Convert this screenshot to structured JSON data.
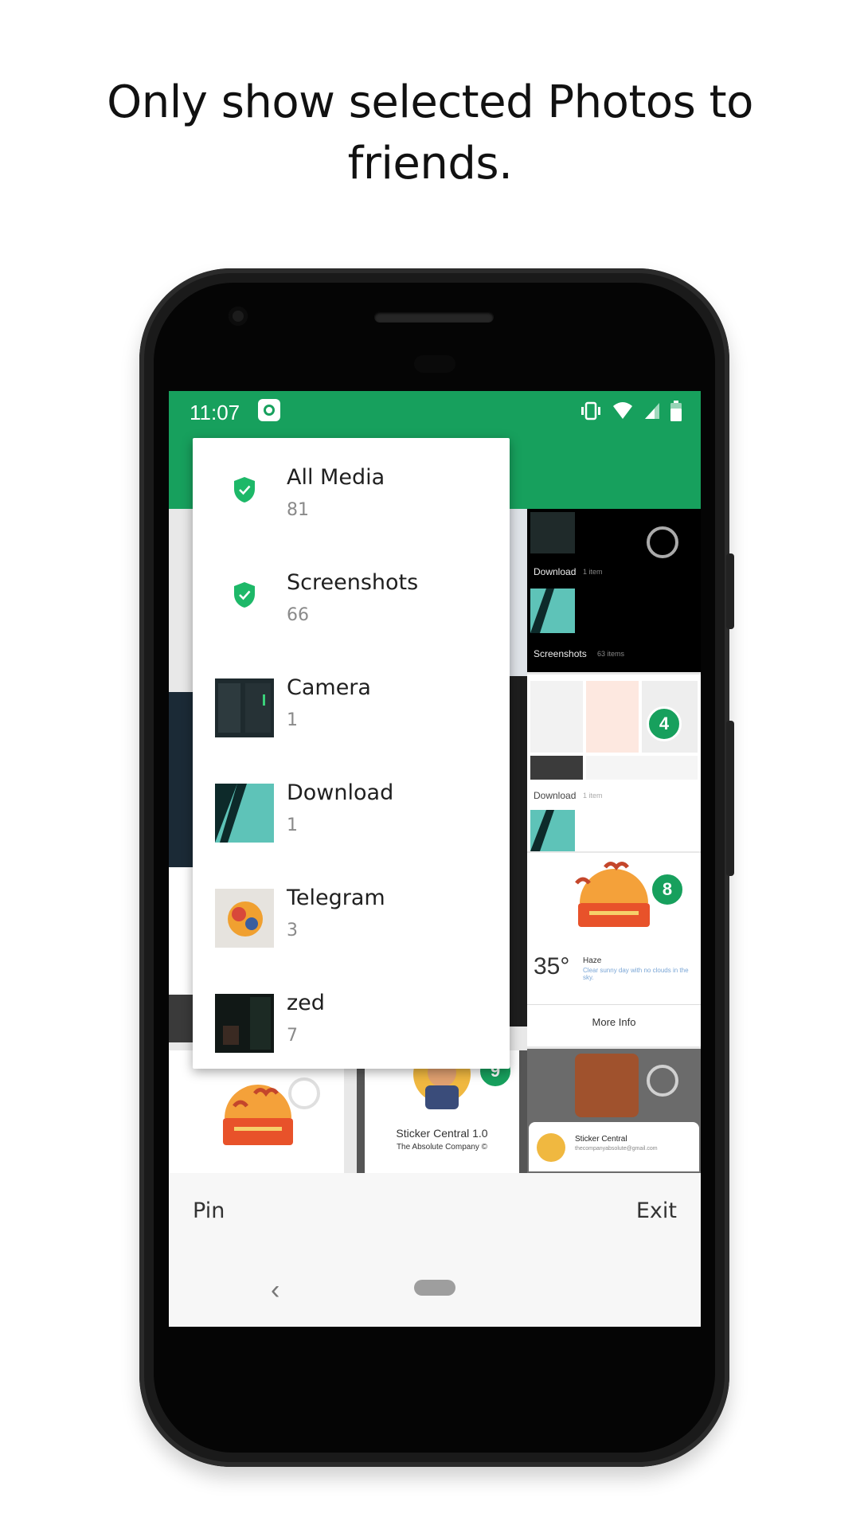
{
  "headline": "Only show selected Photos to friends.",
  "status_bar": {
    "time": "11:07",
    "app_icon": "app-logo-icon",
    "icons": [
      "vibrate-icon",
      "wifi-icon",
      "signal-icon",
      "battery-icon"
    ]
  },
  "colors": {
    "primary": "#17a05d",
    "badge": "#17a05d",
    "menu_bg": "#ffffff"
  },
  "folder_menu": {
    "items": [
      {
        "title": "All Media",
        "count": "81",
        "icon": "shield-icon"
      },
      {
        "title": "Screenshots",
        "count": "66",
        "icon": "shield-icon"
      },
      {
        "title": "Camera",
        "count": "1",
        "icon": "camera-thumbnail"
      },
      {
        "title": "Download",
        "count": "1",
        "icon": "download-thumbnail"
      },
      {
        "title": "Telegram",
        "count": "3",
        "icon": "telegram-thumbnail"
      },
      {
        "title": "zed",
        "count": "7",
        "icon": "zed-thumbnail"
      }
    ]
  },
  "grid": {
    "tile_download_label": "Download",
    "tile_download_count": "1 item",
    "tile_screenshots_label": "Screenshots",
    "tile_screenshots_count": "63 items",
    "tile_download2_label": "Download",
    "tile_download2_count": "1 item",
    "badge_4": "4",
    "badge_8": "8",
    "badge_9": "9",
    "weather_temp": "35°",
    "weather_cond": "Haze",
    "weather_desc": "Clear sunny day with no clouds in the sky.",
    "more_info": "More Info",
    "sticker_title": "Sticker Central 1.0",
    "sticker_company": "The Absolute Company ©",
    "sticker_card_name": "Sticker Central",
    "sticker_card_email": "thecompanyabsolute@gmail.com"
  },
  "bottom_bar": {
    "pin": "Pin",
    "exit": "Exit"
  },
  "nav_bar": {
    "back": "‹"
  }
}
